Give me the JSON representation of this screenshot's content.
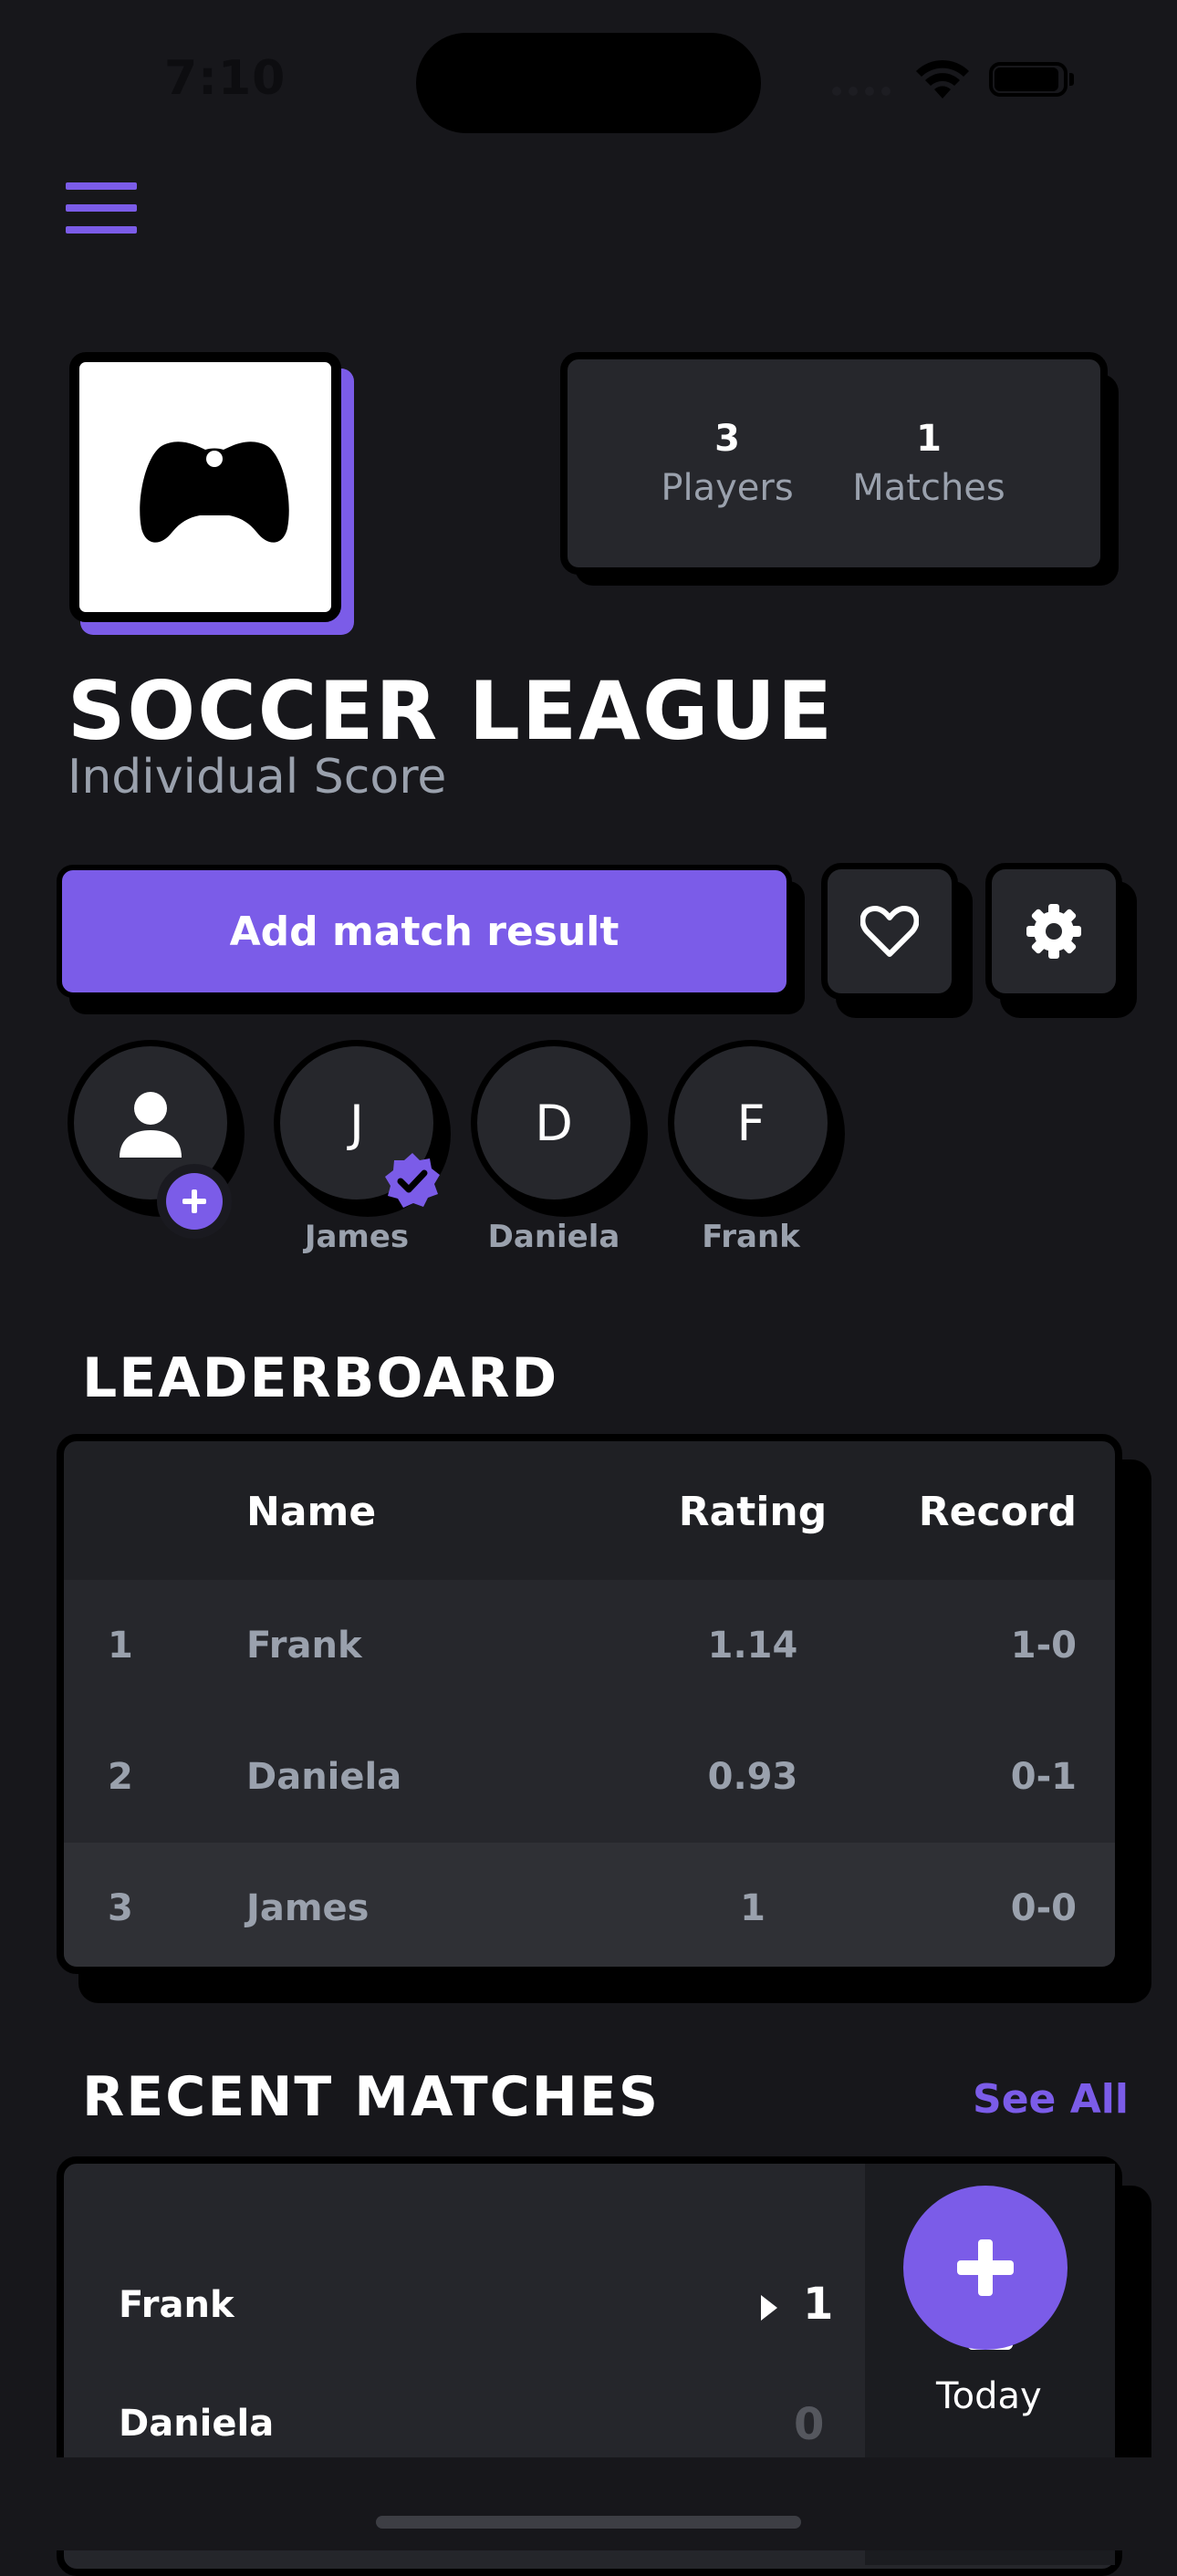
{
  "status_bar": {
    "time": "7:10"
  },
  "league": {
    "title": "SOCCER LEAGUE",
    "subtitle": "Individual Score",
    "players_count": "3",
    "players_label": "Players",
    "matches_count": "1",
    "matches_label": "Matches"
  },
  "actions": {
    "add_match_label": "Add match result"
  },
  "players": [
    {
      "initial": "J",
      "name": "James",
      "verified": true
    },
    {
      "initial": "D",
      "name": "Daniela",
      "verified": false
    },
    {
      "initial": "F",
      "name": "Frank",
      "verified": false
    }
  ],
  "leaderboard": {
    "title": "LEADERBOARD",
    "columns": [
      "Name",
      "Rating",
      "Record"
    ],
    "rows": [
      {
        "rank": "1",
        "name": "Frank",
        "rating": "1.14",
        "record": "1-0"
      },
      {
        "rank": "2",
        "name": "Daniela",
        "rating": "0.93",
        "record": "0-1"
      },
      {
        "rank": "3",
        "name": "James",
        "rating": "1",
        "record": "0-0"
      }
    ]
  },
  "recent_matches": {
    "title": "RECENT MATCHES",
    "see_all": "See All",
    "match": {
      "player1": "Frank",
      "score1": "1",
      "player2": "Daniela",
      "score2": "0",
      "date": "Today"
    }
  },
  "colors": {
    "accent": "#7b5ce8",
    "background": "#17171b",
    "card": "#26272c"
  }
}
